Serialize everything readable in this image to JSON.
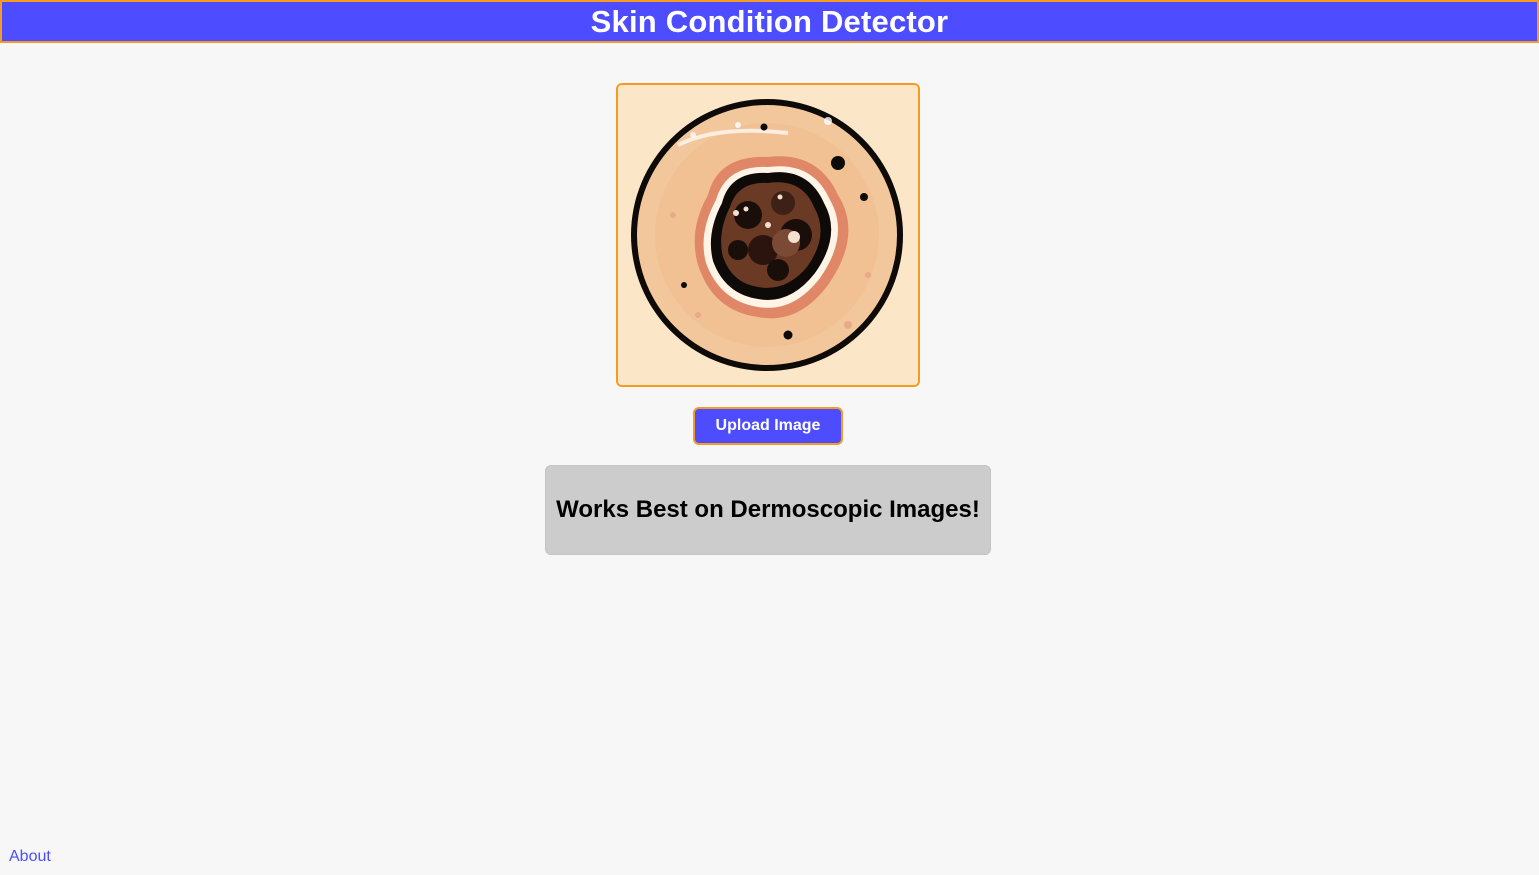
{
  "header": {
    "title": "Skin Condition Detector"
  },
  "preview": {
    "icon": "skin-lesion-illustration"
  },
  "upload": {
    "label": "Upload Image"
  },
  "note": {
    "text": "Works Best on Dermoscopic Images!"
  },
  "footer": {
    "about_label": "About"
  },
  "colors": {
    "header_bg": "#4d4dff",
    "accent_border": "#f59a23",
    "note_bg": "#cccccc",
    "link": "#4d4dff"
  }
}
